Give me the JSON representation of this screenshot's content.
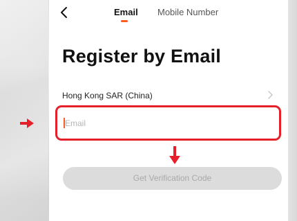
{
  "header": {
    "back_icon": "chevron-left-icon",
    "tabs": [
      {
        "label": "Email",
        "active": true
      },
      {
        "label": "Mobile Number",
        "active": false
      }
    ],
    "active_color": "#ff5a24"
  },
  "page": {
    "title": "Register by Email"
  },
  "region": {
    "label": "Hong Kong SAR (China)",
    "chevron_icon": "chevron-right-icon"
  },
  "email_field": {
    "placeholder": "Email",
    "value": ""
  },
  "verify_button": {
    "label": "Get Verification Code",
    "enabled": false
  },
  "annotations": {
    "highlight_color": "#e5202a",
    "arrow_right_icon": "arrow-right-icon",
    "arrow_down_icon": "arrow-down-icon"
  }
}
